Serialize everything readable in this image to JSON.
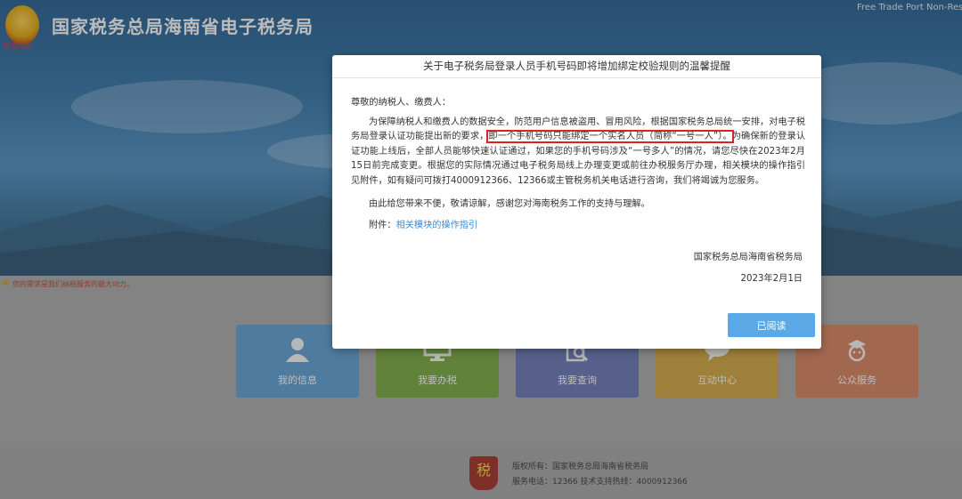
{
  "header": {
    "site_title": "国家税务总局海南省电子税务局",
    "emblem_text": "税务总局",
    "top_right": "Free Trade Port Non-Reside"
  },
  "marquee": {
    "text": "您的需求是我们纳税服务的最大动力。"
  },
  "tiles": [
    {
      "label": "我的信息",
      "icon": "user-icon"
    },
    {
      "label": "我要办税",
      "icon": "monitor-icon"
    },
    {
      "label": "我要查询",
      "icon": "search-doc-icon"
    },
    {
      "label": "互动中心",
      "icon": "chat-icon"
    },
    {
      "label": "公众服务",
      "icon": "people-icon"
    }
  ],
  "footer": {
    "logo_text": "税",
    "line1": "版权所有：国家税务总局海南省税务局",
    "line2": "服务电话：12366 技术支持热线：4000912366"
  },
  "modal": {
    "title": "关于电子税务局登录人员手机号码即将增加绑定校验规则的温馨提醒",
    "greeting": "尊敬的纳税人、缴费人：",
    "para1_a": "为保障纳税人和缴费人的数据安全，防范用户信息被盗用、冒用风险，根据国家税务总局统一安排，对电子税务局登录认证功能提出新的要求，",
    "para1_highlight": "即一个手机号码只能绑定一个实名人员（简称“一号一人”）。",
    "para1_b": "为确保新的登录认证功能上线后，全部人员能够快速认证通过，如果您的手机号码涉及“一号多人”的情况，请您尽快在2023年2月15日前完成变更。根据您的实际情况通过电子税务局线上办理变更或前往办税服务厅办理，相关模块的操作指引见附件，如有疑问可拨打4000912366、12366或主管税务机关电话进行咨询，我们将竭诚为您服务。",
    "para2": "由此给您带来不便，敬请谅解，感谢您对海南税务工作的支持与理解。",
    "attach_label": "附件：",
    "attach_link": "相关模块的操作指引",
    "signature": "国家税务总局海南省税务局",
    "date": "2023年2月1日",
    "read_button": "已阅读"
  }
}
